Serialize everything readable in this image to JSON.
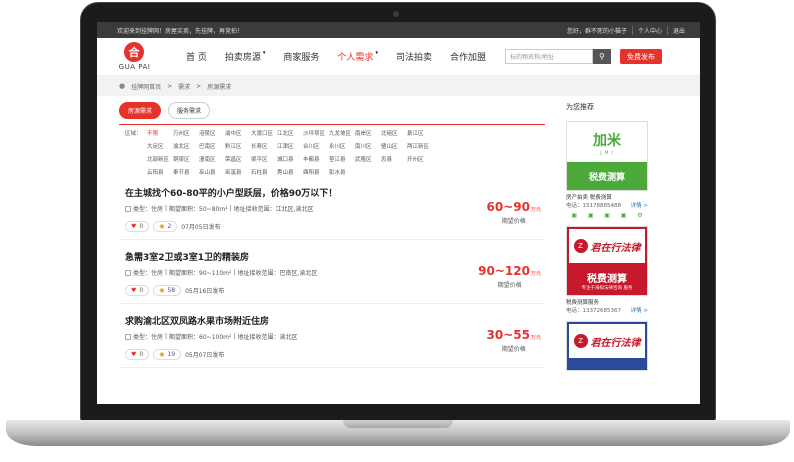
{
  "topbar": {
    "welcome": "欢迎来到挂牌网！房屋买卖，先挂牌，再竞拍！",
    "user": "您好，群不死的小猫子",
    "center": "个人中心",
    "logout": "退出"
  },
  "logo": {
    "mark": "合",
    "text": "GUA PAI"
  },
  "nav": {
    "items": [
      {
        "label": "首 页",
        "caret": ""
      },
      {
        "label": "拍卖房源",
        "caret": "▾"
      },
      {
        "label": "商家服务",
        "caret": ""
      },
      {
        "label": "个人需求",
        "caret": "▾"
      },
      {
        "label": "司法拍卖",
        "caret": ""
      },
      {
        "label": "合作加盟",
        "caret": ""
      }
    ],
    "search_placeholder": "标的物名称/地址",
    "search_icon": "search-icon",
    "publish": "免费发布"
  },
  "breadcrumb": [
    "挂牌网首页",
    "需求",
    "房源需求"
  ],
  "tabs": [
    "房源需求",
    "服务需求"
  ],
  "area_label": "区域：",
  "areas": [
    "不限",
    "万州区",
    "涪陵区",
    "渝中区",
    "大渡口区",
    "江北区",
    "沙坪坝区",
    "九龙坡区",
    "南岸区",
    "北碚区",
    "綦江区",
    "大足区",
    "渝北区",
    "巴南区",
    "黔江区",
    "长寿区",
    "江津区",
    "合川区",
    "永川区",
    "南川区",
    "璧山区",
    "两江新区",
    "北部新区",
    "铜梁区",
    "潼南区",
    "荣昌区",
    "梁平区",
    "城口县",
    "丰都县",
    "垫江县",
    "武隆区",
    "忠县",
    "开州区",
    "云阳县",
    "奉节县",
    "巫山县",
    "巫溪县",
    "石柱县",
    "秀山县",
    "酉阳县",
    "彭水县"
  ],
  "listings": [
    {
      "title": "在主城找个60-80平的小户型跃层，价格90万以下！",
      "type": "类型：住房",
      "area": "期望面积：50~80m²",
      "location": "地址接收范围：江北区,渝北区",
      "likes": "0",
      "views": "2",
      "date": "07月05日发布",
      "price": "60~90",
      "unit": "万元",
      "price_label": "期望价格"
    },
    {
      "title": "急需3室2卫或3室1卫的精装房",
      "type": "类型：住房",
      "area": "期望面积：90~110m²",
      "location": "地址接收范围：巴南区,渝北区",
      "likes": "0",
      "views": "58",
      "date": "05月16日发布",
      "price": "90~120",
      "unit": "万元",
      "price_label": "期望价格"
    },
    {
      "title": "求购渝北区双凤路水果市场附近住房",
      "type": "类型：住房",
      "area": "期望面积：60~100m²",
      "location": "地址接收范围：渝北区",
      "likes": "0",
      "views": "19",
      "date": "05月07日发布",
      "price": "30~55",
      "unit": "万元",
      "price_label": "期望价格"
    }
  ],
  "sidebar": {
    "title": "为您推荐",
    "ad1": {
      "brand": "加米",
      "brand_sub": "J M I",
      "banner": "税费测算",
      "banner_sub": "",
      "name": "房产拍卖 税费测算",
      "phone": "电话：15178885488",
      "detail": "详情 >"
    },
    "ad2": {
      "mark": "Z",
      "cal": "君在行法律",
      "banner": "税费测算",
      "banner_sub": "专注于海拟法律咨询 服务",
      "name": "税费测算服务",
      "phone": "电话：13372685367",
      "detail": "详情 >"
    },
    "ad3": {
      "mark": "Z",
      "cal": "君在行法律"
    }
  }
}
